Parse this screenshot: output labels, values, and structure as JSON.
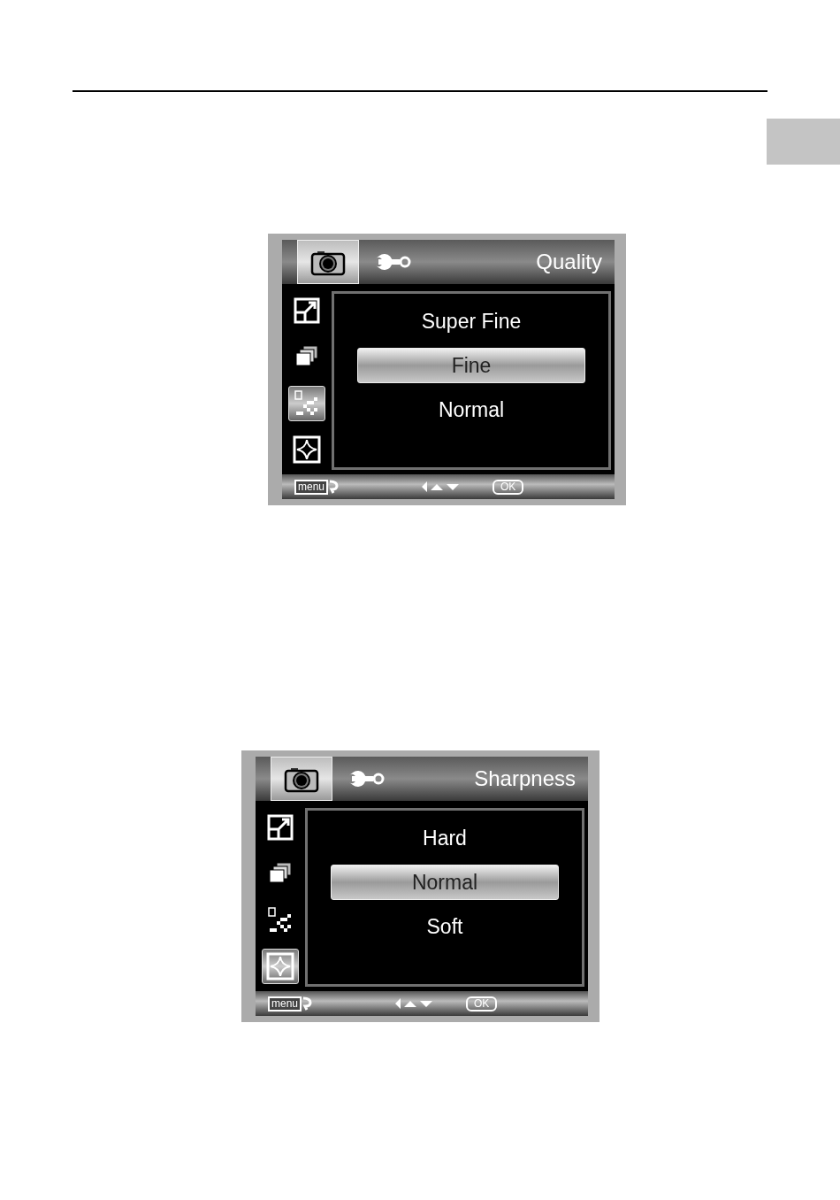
{
  "screens": [
    {
      "title": "Quality",
      "tabs": [
        {
          "kind": "camera",
          "selected": true
        },
        {
          "kind": "setup",
          "selected": false
        }
      ],
      "side_items": [
        {
          "kind": "size",
          "selected": false
        },
        {
          "kind": "burst",
          "selected": false
        },
        {
          "kind": "quality",
          "selected": true
        },
        {
          "kind": "sharpness",
          "selected": false
        }
      ],
      "options": [
        {
          "label": "Super Fine",
          "selected": false
        },
        {
          "label": "Fine",
          "selected": true
        },
        {
          "label": "Normal",
          "selected": false
        }
      ],
      "footer": {
        "menu": "menu",
        "ok": "OK"
      }
    },
    {
      "title": "Sharpness",
      "tabs": [
        {
          "kind": "camera",
          "selected": true
        },
        {
          "kind": "setup",
          "selected": false
        }
      ],
      "side_items": [
        {
          "kind": "size",
          "selected": false
        },
        {
          "kind": "burst",
          "selected": false
        },
        {
          "kind": "quality",
          "selected": false
        },
        {
          "kind": "sharpness",
          "selected": true
        }
      ],
      "options": [
        {
          "label": "Hard",
          "selected": false
        },
        {
          "label": "Normal",
          "selected": true
        },
        {
          "label": "Soft",
          "selected": false
        }
      ],
      "footer": {
        "menu": "menu",
        "ok": "OK"
      }
    }
  ]
}
